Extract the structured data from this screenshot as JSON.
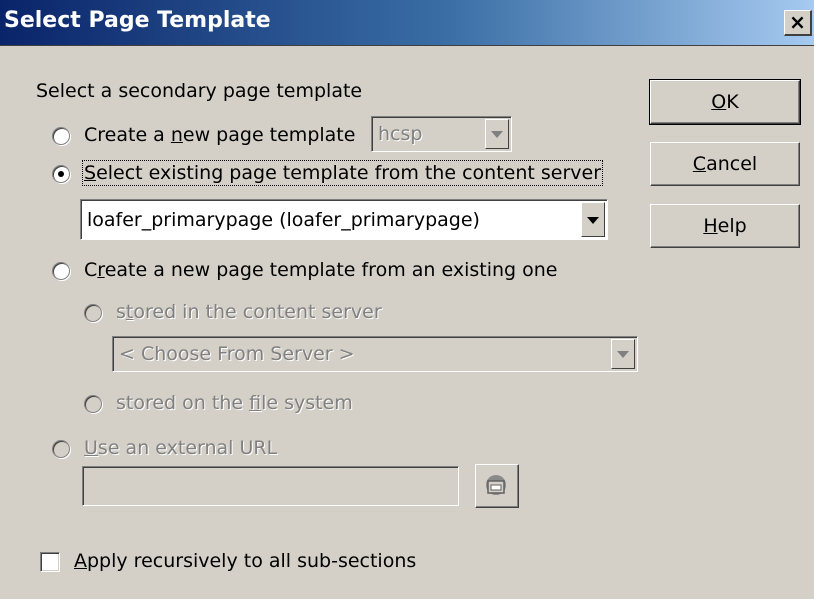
{
  "window": {
    "title": "Select Page Template",
    "close_glyph": "×"
  },
  "dialog": {
    "heading": "Select a secondary page template",
    "options": {
      "create_new": {
        "pre": "Create a ",
        "key": "n",
        "post": "ew page template",
        "selected": false
      },
      "select_existing": {
        "pre": "",
        "key": "S",
        "post": "elect existing page template from the content server",
        "selected": true
      },
      "from_existing": {
        "pre": "C",
        "key": "r",
        "post": "eate a new page template from an existing one",
        "selected": false
      },
      "stored_content_server": {
        "pre": "s",
        "key": "t",
        "post": "ored in the content server",
        "selected": false,
        "disabled": true
      },
      "stored_file_system": {
        "pre": "stored on the ",
        "key": "f",
        "post": "ile system",
        "selected": false,
        "disabled": true
      },
      "external_url": {
        "pre": "",
        "key": "U",
        "post": "se an external URL",
        "selected": false,
        "disabled": true
      }
    },
    "type_combo": {
      "value": "hcsp",
      "disabled": true
    },
    "existing_combo": {
      "value": "loafer_primarypage (loafer_primarypage)"
    },
    "server_combo": {
      "value": "< Choose From Server >",
      "disabled": true
    },
    "url_field": {
      "value": ""
    },
    "recursive_checkbox": {
      "pre": "",
      "key": "A",
      "post": "pply recursively to all sub-sections",
      "checked": false
    }
  },
  "buttons": {
    "ok": {
      "pre": "",
      "key": "O",
      "post": "K"
    },
    "cancel": {
      "pre": "",
      "key": "C",
      "post": "ancel"
    },
    "help": {
      "pre": "",
      "key": "H",
      "post": "elp"
    }
  },
  "icons": {
    "browse": "folder-browse-icon"
  },
  "colors": {
    "titlebar_start": "#0a246a",
    "titlebar_end": "#a6caf0",
    "dialog_bg": "#d4d0c8",
    "disabled_text": "#808080"
  }
}
